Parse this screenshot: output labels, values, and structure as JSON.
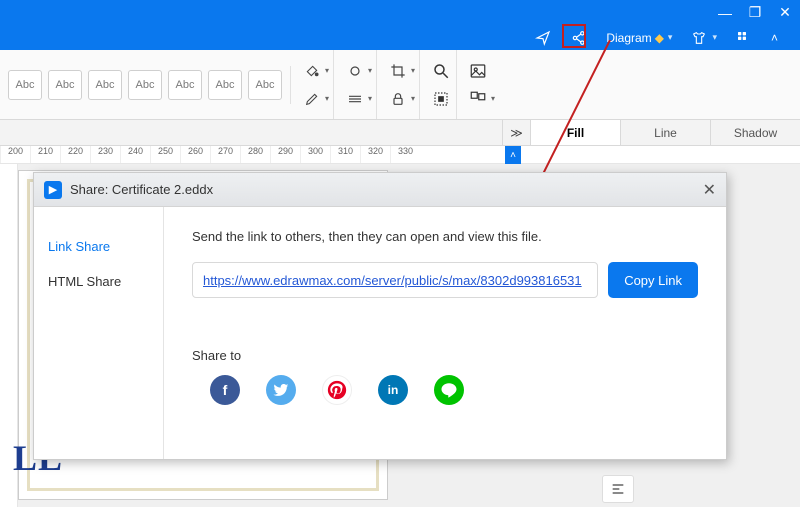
{
  "title": "Diagram",
  "win": {
    "min": "—",
    "max": "❐",
    "close": "✕"
  },
  "topbar": {
    "send_icon": "send-icon",
    "share_icon": "share-icon",
    "diagram_label": "Diagram",
    "diamond": "◆",
    "grid_icon": "apps-icon",
    "tshirt_icon": "shirt-icon",
    "chev": "˄"
  },
  "ribbon": {
    "abc": [
      "Abc",
      "Abc",
      "Abc",
      "Abc",
      "Abc",
      "Abc",
      "Abc"
    ]
  },
  "ruler": {
    "ticks": [
      "200",
      "210",
      "220",
      "230",
      "240",
      "250",
      "260",
      "270",
      "280",
      "290",
      "300",
      "310",
      "320",
      "330"
    ]
  },
  "panel_tabs": {
    "fill": "Fill",
    "line": "Line",
    "shadow": "Shadow",
    "collapse": "≫"
  },
  "page_sample": "LL",
  "modal": {
    "title": "Share: Certificate 2.eddx",
    "close": "✕",
    "tab_link": "Link Share",
    "tab_html": "HTML Share",
    "desc": "Send the link to others, then they can open and view this file.",
    "url": "https://www.edrawmax.com/server/public/s/max/8302d993816531",
    "copy": "Copy Link",
    "share_to": "Share to",
    "icons": {
      "fb": "f",
      "tw": "🐦",
      "pn": "𝓟",
      "in": "in",
      "ln": "LINE"
    }
  }
}
